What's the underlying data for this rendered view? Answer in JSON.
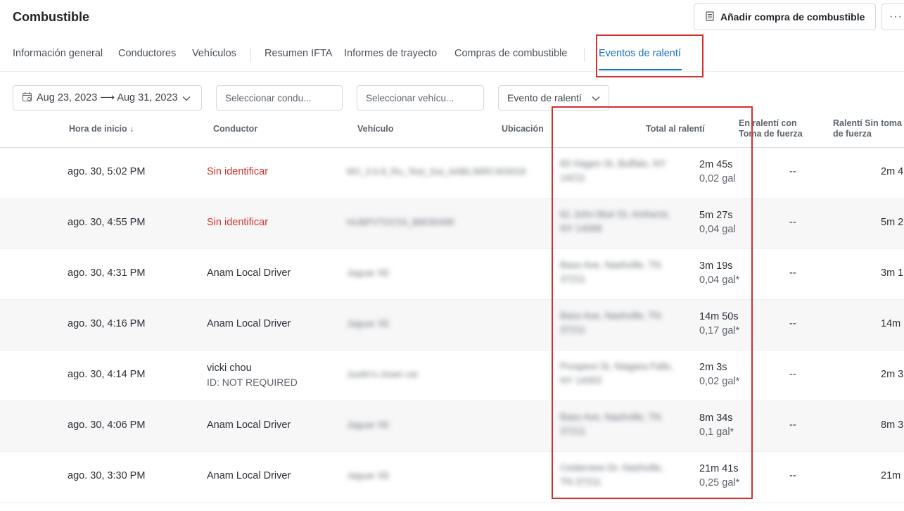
{
  "header": {
    "title": "Combustible",
    "add_button_label": "Añadir compra de combustible",
    "more_label": "···"
  },
  "tabs": [
    {
      "label": "Información general"
    },
    {
      "label": "Conductores"
    },
    {
      "label": "Vehículos"
    },
    {
      "label": "Resumen IFTA"
    },
    {
      "label": "Informes de trayecto"
    },
    {
      "label": "Compras de combustible"
    },
    {
      "label": "Eventos de ralentí",
      "active": true
    }
  ],
  "filters": {
    "date_range": "Aug 23, 2023 ⟶ Aug 31, 2023",
    "driver_placeholder": "Seleccionar condu...",
    "vehicle_placeholder": "Seleccionar vehícu...",
    "event_type": "Evento de ralentí"
  },
  "columns": {
    "start_time": "Hora de inicio ↓",
    "driver": "Conductor",
    "vehicle": "Vehículo",
    "location": "Ubicación",
    "total_idle": "Total al ralentí",
    "idle_pto": "En ralentí con Toma de fuerza",
    "idle_no_pto": "Ralentí Sin toma de fuerza"
  },
  "rows": [
    {
      "time": "ago. 30, 5:02 PM",
      "driver": "Sin identificar",
      "driver_unidentified": true,
      "vehicle": "MV_3.6.8_Ru_Test_Sut_AABL36RC403018",
      "location1": "83 Hagen St, Buffalo, NY",
      "location2": "14211",
      "duration": "2m 45s",
      "fuel": "0,02 gal",
      "pto": "--",
      "no_pto": "2m 4"
    },
    {
      "time": "ago. 30, 4:55 PM",
      "driver": "Sin identificar",
      "driver_unidentified": true,
      "vehicle": "HUBPVTDC54_B8030498",
      "location1": "81 John Muir Dr, Amherst,",
      "location2": "NY 14068",
      "duration": "5m 27s",
      "fuel": "0,04 gal",
      "pto": "--",
      "no_pto": "5m 2"
    },
    {
      "time": "ago. 30, 4:31 PM",
      "driver": "Anam Local Driver",
      "vehicle": "Jaguar XE",
      "location1": "Bass Ave, Nashville, TN",
      "location2": "37211",
      "duration": "3m 19s",
      "fuel": "0,04 gal*",
      "pto": "--",
      "no_pto": "3m 1"
    },
    {
      "time": "ago. 30, 4:16 PM",
      "driver": "Anam Local Driver",
      "vehicle": "Jaguar XE",
      "location1": "Bass Ave, Nashville, TN",
      "location2": "37211",
      "duration": "14m 50s",
      "fuel": "0,17 gal*",
      "pto": "--",
      "no_pto": "14m"
    },
    {
      "time": "ago. 30, 4:14 PM",
      "driver": "vicki chou",
      "driver_id": "ID: NOT REQUIRED",
      "vehicle": "Justin's clown car",
      "location1": "Prospect St, Niagara Falls,",
      "location2": "NY 14302",
      "duration": "2m 3s",
      "fuel": "0,02 gal*",
      "pto": "--",
      "no_pto": "2m 3"
    },
    {
      "time": "ago. 30, 4:06 PM",
      "driver": "Anam Local Driver",
      "vehicle": "Jaguar XE",
      "location1": "Bass Ave, Nashville, TN",
      "location2": "37211",
      "duration": "8m 34s",
      "fuel": "0,1 gal*",
      "pto": "--",
      "no_pto": "8m 3"
    },
    {
      "time": "ago. 30, 3:30 PM",
      "driver": "Anam Local Driver",
      "vehicle": "Jaguar XE",
      "location1": "Cedarview Dr, Nashville,",
      "location2": "TN 37211",
      "duration": "21m 41s",
      "fuel": "0,25 gal*",
      "pto": "--",
      "no_pto": "21m"
    }
  ],
  "colors": {
    "accent": "#1570c6",
    "unidentified": "#d9302c",
    "highlight": "#d0312f"
  }
}
